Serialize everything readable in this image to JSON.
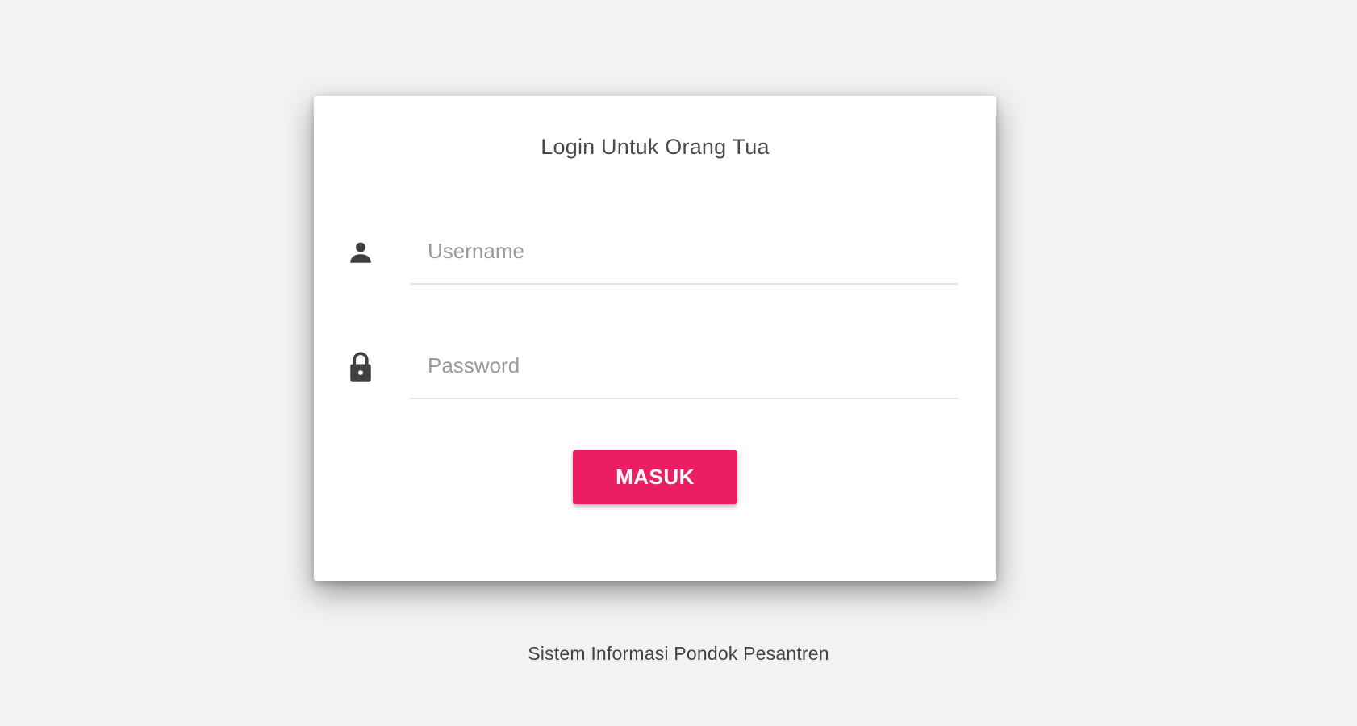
{
  "login": {
    "title": "Login Untuk Orang Tua",
    "username": {
      "placeholder": "Username",
      "value": "",
      "icon": "person-icon"
    },
    "password": {
      "placeholder": "Password",
      "value": "",
      "icon": "lock-icon"
    },
    "submit_label": "MASUK"
  },
  "footer": {
    "text": "Sistem Informasi Pondok Pesantren"
  },
  "colors": {
    "accent": "#e91e63",
    "background": "#f2f2f2",
    "card": "#ffffff",
    "icon": "#404040"
  }
}
